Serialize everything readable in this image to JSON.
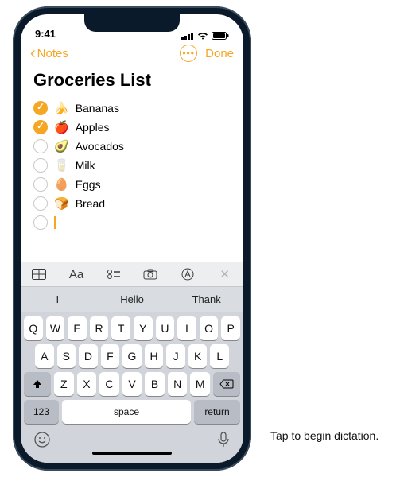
{
  "statusbar": {
    "time": "9:41"
  },
  "nav": {
    "back": "Notes",
    "done": "Done"
  },
  "note": {
    "title": "Groceries List",
    "items": [
      {
        "emoji": "🍌",
        "label": "Bananas",
        "checked": true
      },
      {
        "emoji": "🍎",
        "label": "Apples",
        "checked": true
      },
      {
        "emoji": "🥑",
        "label": "Avocados",
        "checked": false
      },
      {
        "emoji": "🥛",
        "label": "Milk",
        "checked": false
      },
      {
        "emoji": "🥚",
        "label": "Eggs",
        "checked": false
      },
      {
        "emoji": "🍞",
        "label": "Bread",
        "checked": false
      }
    ]
  },
  "predictive": {
    "a": "I",
    "b": "Hello",
    "c": "Thank"
  },
  "keyboard": {
    "row1": [
      "Q",
      "W",
      "E",
      "R",
      "T",
      "Y",
      "U",
      "I",
      "O",
      "P"
    ],
    "row2": [
      "A",
      "S",
      "D",
      "F",
      "G",
      "H",
      "J",
      "K",
      "L"
    ],
    "row3": [
      "Z",
      "X",
      "C",
      "V",
      "B",
      "N",
      "M"
    ],
    "numkey": "123",
    "space": "space",
    "return": "return",
    "formatAa": "Aa"
  },
  "callout": "Tap to begin dictation."
}
